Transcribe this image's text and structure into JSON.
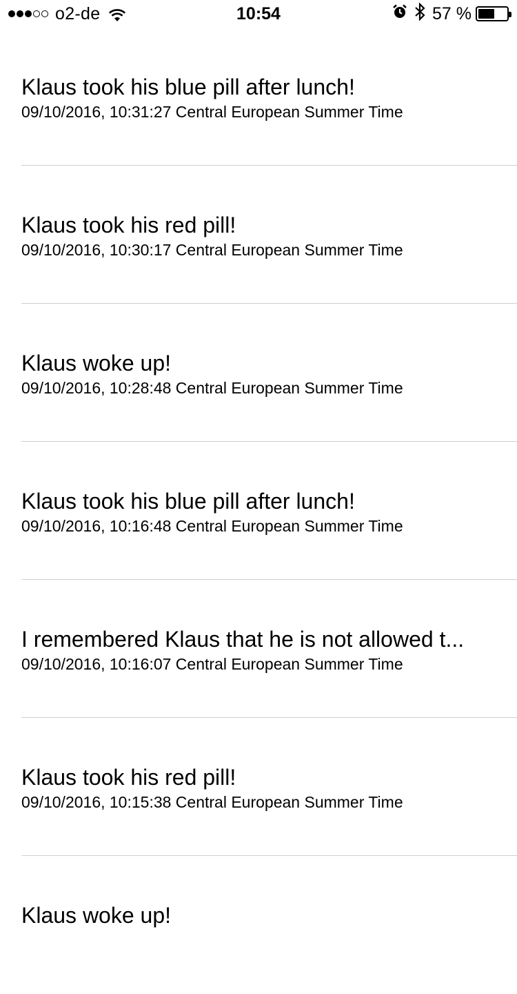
{
  "status_bar": {
    "signal_dots_filled": 3,
    "signal_dots_total": 5,
    "carrier": "o2-de",
    "time": "10:54",
    "battery_percent_label": "57 %",
    "battery_level": 0.57,
    "icons": [
      "wifi-icon",
      "alarm-icon",
      "bluetooth-icon",
      "battery-icon"
    ]
  },
  "entries": [
    {
      "title": "Klaus took his blue pill after lunch!",
      "time": "09/10/2016, 10:31:27 Central European Summer Time"
    },
    {
      "title": "Klaus took his red pill!",
      "time": "09/10/2016, 10:30:17 Central European Summer Time"
    },
    {
      "title": "Klaus woke up!",
      "time": "09/10/2016, 10:28:48 Central European Summer Time"
    },
    {
      "title": "Klaus took his blue pill after lunch!",
      "time": "09/10/2016, 10:16:48 Central European Summer Time"
    },
    {
      "title": "I remembered Klaus that he is not allowed t...",
      "time": "09/10/2016, 10:16:07 Central European Summer Time"
    },
    {
      "title": "Klaus took his red pill!",
      "time": "09/10/2016, 10:15:38 Central European Summer Time"
    },
    {
      "title": "Klaus woke up!",
      "time": ""
    }
  ]
}
